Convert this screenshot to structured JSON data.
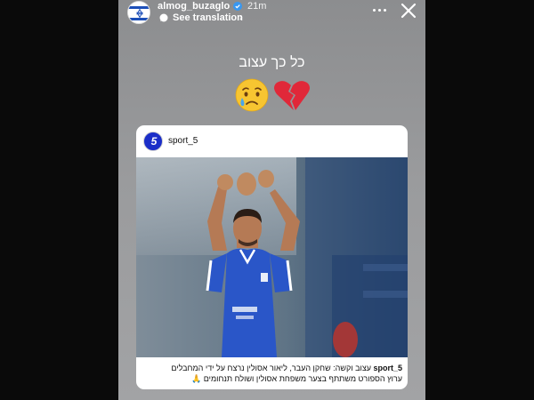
{
  "story": {
    "username": "almog_buzaglo",
    "time": "21m",
    "translate_label": "See translation",
    "caption": "כל כך עצוב",
    "emojis": [
      "crying-face",
      "broken-heart"
    ]
  },
  "post": {
    "username": "sport_5",
    "avatar_letter": "5",
    "caption_user": "sport_5",
    "caption_line1": "עצוב וקשה: שחקן העבר, ליאור אסולין נרצח על ידי המחבלים",
    "caption_line2": "ערוץ הספורט משתתף בצער משפחת אסולין ושולח תנחומים 🙏"
  },
  "colors": {
    "story_bg": "#9a9b9d",
    "card_bg": "#ffffff",
    "jersey_blue": "#2a56c8",
    "sport5_brand": "#1b2ec8"
  },
  "icons": [
    "israel-flag-icon",
    "verified-badge-icon",
    "translate-bubble-icon",
    "chevron-right-icon",
    "more-dots-icon",
    "close-icon"
  ]
}
